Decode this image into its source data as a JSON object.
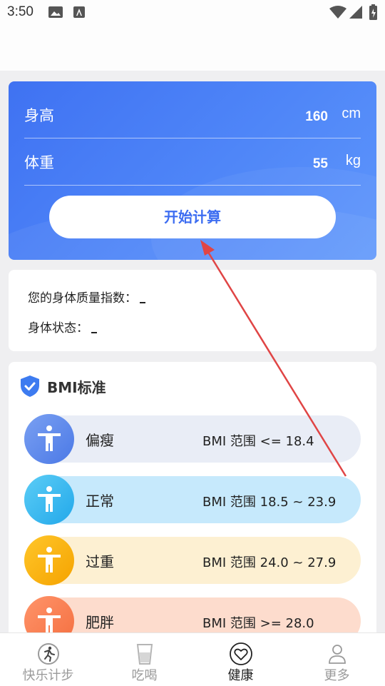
{
  "status": {
    "time": "3:50"
  },
  "calculator": {
    "height_label": "身高",
    "height_value": "160",
    "height_unit": "cm",
    "weight_label": "体重",
    "weight_value": "55",
    "weight_unit": "kg",
    "button_label": "开始计算"
  },
  "result": {
    "bmi_label": "您的身体质量指数：",
    "state_label": "身体状态："
  },
  "standard": {
    "title": "BMI标准",
    "rows": [
      {
        "name": "偏瘦",
        "range": "BMI 范围 <= 18.4"
      },
      {
        "name": "正常",
        "range": "BMI 范围 18.5 ~ 23.9"
      },
      {
        "name": "过重",
        "range": "BMI 范围 24.0 ~ 27.9"
      },
      {
        "name": "肥胖",
        "range": "BMI 范围 >= 28.0"
      }
    ]
  },
  "tabs": [
    {
      "label": "快乐计步",
      "icon": "runner-icon"
    },
    {
      "label": "吃喝",
      "icon": "cup-icon"
    },
    {
      "label": "健康",
      "icon": "heart-icon",
      "active": true
    },
    {
      "label": "更多",
      "icon": "person-icon"
    }
  ],
  "colors": {
    "accent": "#3d6df1",
    "active_tab": "#222222",
    "inactive_tab": "#9a9a9a"
  }
}
